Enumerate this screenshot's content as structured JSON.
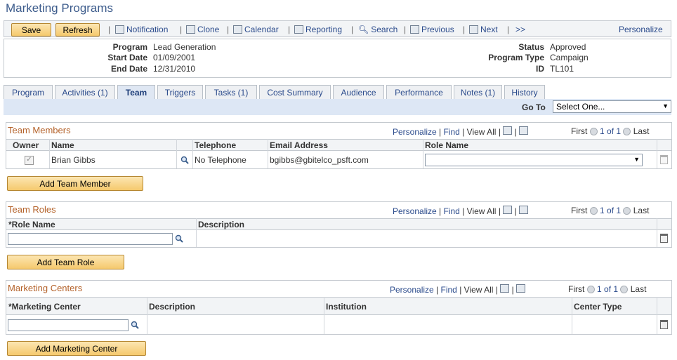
{
  "page": {
    "title": "Marketing Programs"
  },
  "toolbar": {
    "save": "Save",
    "refresh": "Refresh",
    "notification": "Notification",
    "clone": "Clone",
    "calendar": "Calendar",
    "reporting": "Reporting",
    "search": "Search",
    "previous": "Previous",
    "next": "Next",
    "more": ">>",
    "personalize": "Personalize"
  },
  "header": {
    "program_label": "Program",
    "program_value": "Lead Generation",
    "start_label": "Start Date",
    "start_value": "01/09/2001",
    "end_label": "End Date",
    "end_value": "12/31/2010",
    "status_label": "Status",
    "status_value": "Approved",
    "type_label": "Program Type",
    "type_value": "Campaign",
    "id_label": "ID",
    "id_value": "TL101"
  },
  "tabs": [
    "Program",
    "Activities (1)",
    "Team",
    "Triggers",
    "Tasks (1)",
    "Cost Summary",
    "Audience",
    "Performance",
    "Notes (1)",
    "History"
  ],
  "goto": {
    "label": "Go To",
    "value": "Select One..."
  },
  "nav": {
    "personalize": "Personalize",
    "find": "Find",
    "view_all": "View All",
    "first": "First",
    "count": "1 of 1",
    "last": "Last",
    "sep": "|"
  },
  "team_members": {
    "title": "Team Members",
    "headers": {
      "owner": "Owner",
      "name": "Name",
      "telephone": "Telephone",
      "email": "Email Address",
      "role": "Role Name"
    },
    "row": {
      "owner_checked": true,
      "name": "Brian Gibbs",
      "telephone": "No Telephone",
      "email": "bgibbs@gbitelco_psft.com",
      "role": ""
    },
    "add_button": "Add Team Member"
  },
  "team_roles": {
    "title": "Team Roles",
    "headers": {
      "role": "*Role Name",
      "description": "Description"
    },
    "add_button": "Add Team Role"
  },
  "marketing_centers": {
    "title": "Marketing Centers",
    "headers": {
      "center": "*Marketing Center",
      "description": "Description",
      "institution": "Institution",
      "center_type": "Center Type"
    },
    "add_button": "Add Marketing Center"
  }
}
